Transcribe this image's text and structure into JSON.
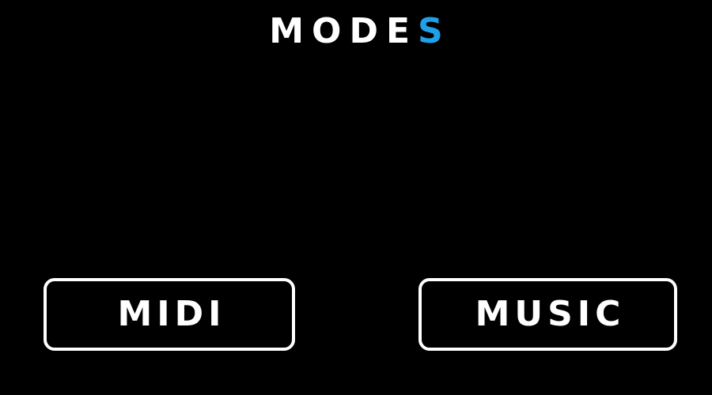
{
  "header": {
    "title_main": "MODE",
    "title_accent": "S"
  },
  "colors": {
    "background": "#000000",
    "foreground": "#ffffff",
    "accent": "#1ea1e6"
  },
  "modes": [
    {
      "label": "MIDI"
    },
    {
      "label": "MUSIC"
    }
  ]
}
